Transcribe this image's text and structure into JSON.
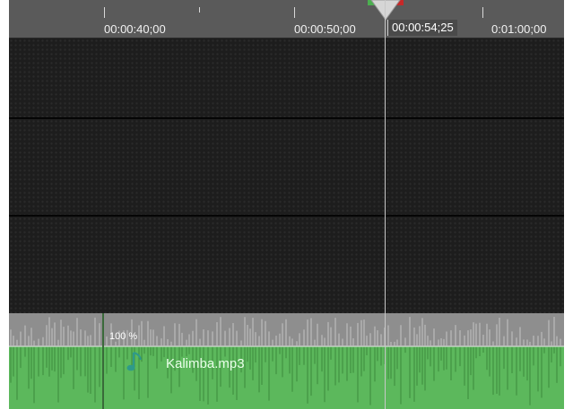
{
  "ruler": {
    "ticks": [
      "00:00:40;00",
      "00:00:50;00",
      "0:01:00;00"
    ],
    "current_time": "00:00:54;25"
  },
  "clip": {
    "name": "Kalimba.mp3",
    "volume": "100 %",
    "icon": "music-note-icon",
    "colors": {
      "clip_fill": "#5cb85c",
      "volume_band": "#8e8e8e",
      "waveform": "#3d8a3d"
    }
  }
}
